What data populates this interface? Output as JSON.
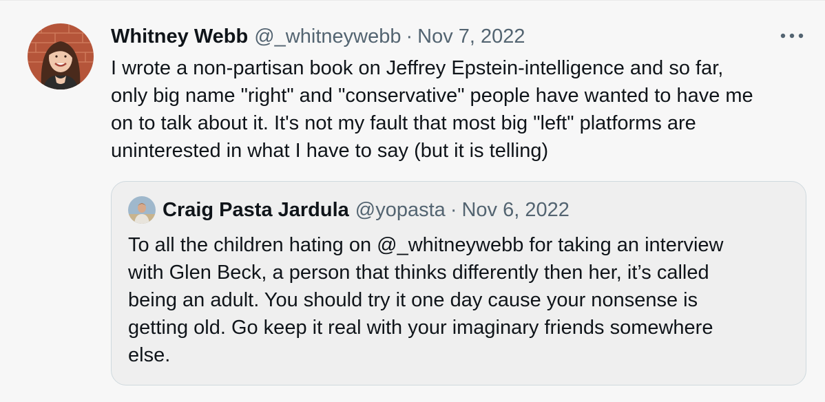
{
  "tweet": {
    "author_name": "Whitney Webb",
    "author_handle": "@_whitneywebb",
    "separator": "·",
    "date": "Nov 7, 2022",
    "more_icon": "more-horizontal-icon",
    "text_lines": [
      "I wrote a non-partisan book on Jeffrey Epstein-intelligence and so far,",
      "only big name \"right\" and \"conservative\" people have wanted to have me",
      "on to talk about it. It's not my fault that most big \"left\" platforms are",
      "uninterested in what I have to say (but it is telling)"
    ]
  },
  "quoted_tweet": {
    "author_name": "Craig Pasta Jardula",
    "author_handle": "@yopasta",
    "separator": "·",
    "date": "Nov 6, 2022",
    "text_lines": [
      "To all the children hating on @_whitneywebb for taking an interview",
      "with Glen Beck, a person that thinks differently then her, it’s called",
      "being an adult. You should try it one day cause your nonsense is",
      "getting old. Go keep it real with your imaginary friends somewhere",
      "else."
    ]
  },
  "colors": {
    "background": "#f7f7f7",
    "primary_text": "#0f1419",
    "secondary_text": "#536471",
    "quote_border": "#cfd9de",
    "quote_background": "#efefef"
  }
}
